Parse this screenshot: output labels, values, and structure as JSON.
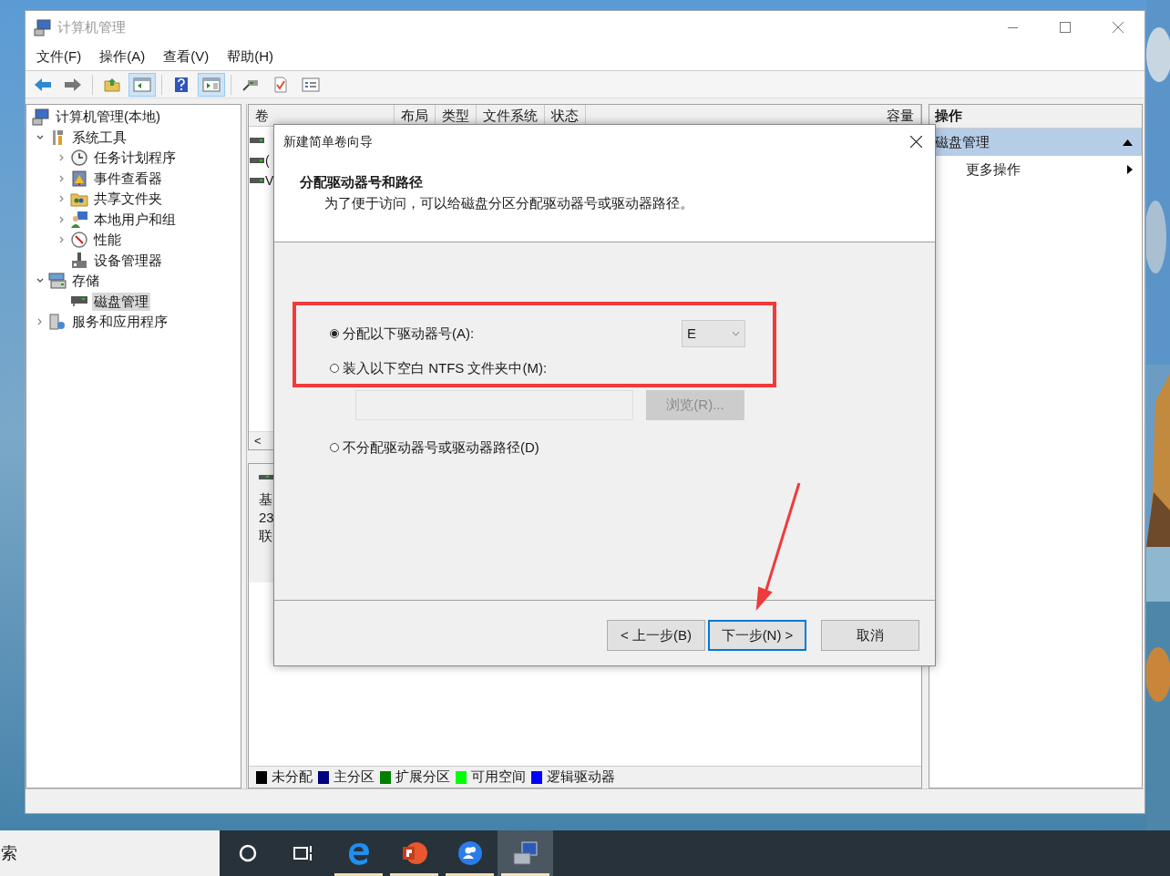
{
  "window": {
    "title": "计算机管理"
  },
  "menu": [
    "文件(F)",
    "操作(A)",
    "查看(V)",
    "帮助(H)"
  ],
  "toolbar": [
    [
      {
        "kind": "back",
        "selected": false
      },
      {
        "kind": "forward",
        "selected": false
      }
    ],
    [
      {
        "kind": "up",
        "selected": false
      },
      {
        "kind": "tree",
        "selected": true
      }
    ],
    [
      {
        "kind": "help",
        "selected": false
      },
      {
        "kind": "pane",
        "selected": true
      }
    ],
    [
      {
        "kind": "connect",
        "selected": false
      },
      {
        "kind": "check",
        "selected": false
      },
      {
        "kind": "list",
        "selected": false
      }
    ]
  ],
  "tree": [
    {
      "label": "计算机管理(本地)",
      "kind": "computer",
      "selected": false,
      "children": [
        {
          "label": "系统工具",
          "kind": "tools",
          "expanded": true,
          "selected": false,
          "children": [
            {
              "label": "任务计划程序",
              "kind": "clock",
              "expanded": false,
              "selected": false
            },
            {
              "label": "事件查看器",
              "kind": "events",
              "expanded": false,
              "selected": false
            },
            {
              "label": "共享文件夹",
              "kind": "share",
              "expanded": false,
              "selected": false
            },
            {
              "label": "本地用户和组",
              "kind": "users",
              "expanded": false,
              "selected": false
            },
            {
              "label": "性能",
              "kind": "performance",
              "expanded": false,
              "selected": false
            },
            {
              "label": "设备管理器",
              "kind": "devices",
              "selected": false
            }
          ]
        },
        {
          "label": "存储",
          "kind": "storage",
          "expanded": true,
          "selected": false,
          "children": [
            {
              "label": "磁盘管理",
              "kind": "disk",
              "selected": true
            }
          ]
        },
        {
          "label": "服务和应用程序",
          "kind": "services",
          "expanded": false,
          "selected": false
        }
      ]
    }
  ],
  "volumes": {
    "columns": [
      "卷",
      "布局",
      "类型",
      "文件系统",
      "状态",
      "容量"
    ],
    "rows": [
      {
        "kind": "volume"
      },
      {
        "kind": "volume",
        "name": "("
      },
      {
        "kind": "volume",
        "name": "V"
      }
    ],
    "scroll_left": "<"
  },
  "disk": {
    "lines": [
      "基",
      "23",
      "联"
    ]
  },
  "legend": [
    {
      "label": "未分配",
      "color": "#000000"
    },
    {
      "label": "主分区",
      "color": "#000080"
    },
    {
      "label": "扩展分区",
      "color": "#008000"
    },
    {
      "label": "可用空间",
      "color": "#00ff00"
    },
    {
      "label": "逻辑驱动器",
      "color": "#0000ff"
    }
  ],
  "actions": {
    "title": "操作",
    "items": [
      {
        "label": "磁盘管理",
        "kind": "section",
        "selected": true
      },
      {
        "label": "更多操作",
        "kind": "submenu",
        "selected": false
      }
    ]
  },
  "dialog": {
    "title": "新建简单卷向导",
    "heading": "分配驱动器号和路径",
    "description": "为了便于访问，可以给磁盘分区分配驱动器号或驱动器路径。",
    "options": [
      {
        "kind": "drive_letter",
        "label": "分配以下驱动器号(A):",
        "selected": true,
        "value": "E"
      },
      {
        "kind": "folder",
        "label": "装入以下空白 NTFS 文件夹中(M):",
        "selected": false,
        "browse": "浏览(R)...",
        "disabled": true
      },
      {
        "kind": "none",
        "label": "不分配驱动器号或驱动器路径(D)",
        "selected": false
      }
    ],
    "buttons": [
      {
        "label": "< 上一步(B)",
        "default": false
      },
      {
        "label": "下一步(N) >",
        "default": true
      },
      {
        "label": "取消",
        "default": false
      }
    ]
  },
  "annotations": {
    "highlight_box": true,
    "arrow": true
  },
  "taskbar": {
    "search": "索",
    "items": [
      {
        "kind": "cortana",
        "running": false,
        "active": false
      },
      {
        "kind": "taskview",
        "running": false,
        "active": false
      },
      {
        "kind": "browser",
        "running": true,
        "active": false
      },
      {
        "kind": "slides",
        "running": true,
        "active": false
      },
      {
        "kind": "people",
        "running": true,
        "active": false
      },
      {
        "kind": "computer",
        "running": true,
        "active": true
      }
    ]
  }
}
